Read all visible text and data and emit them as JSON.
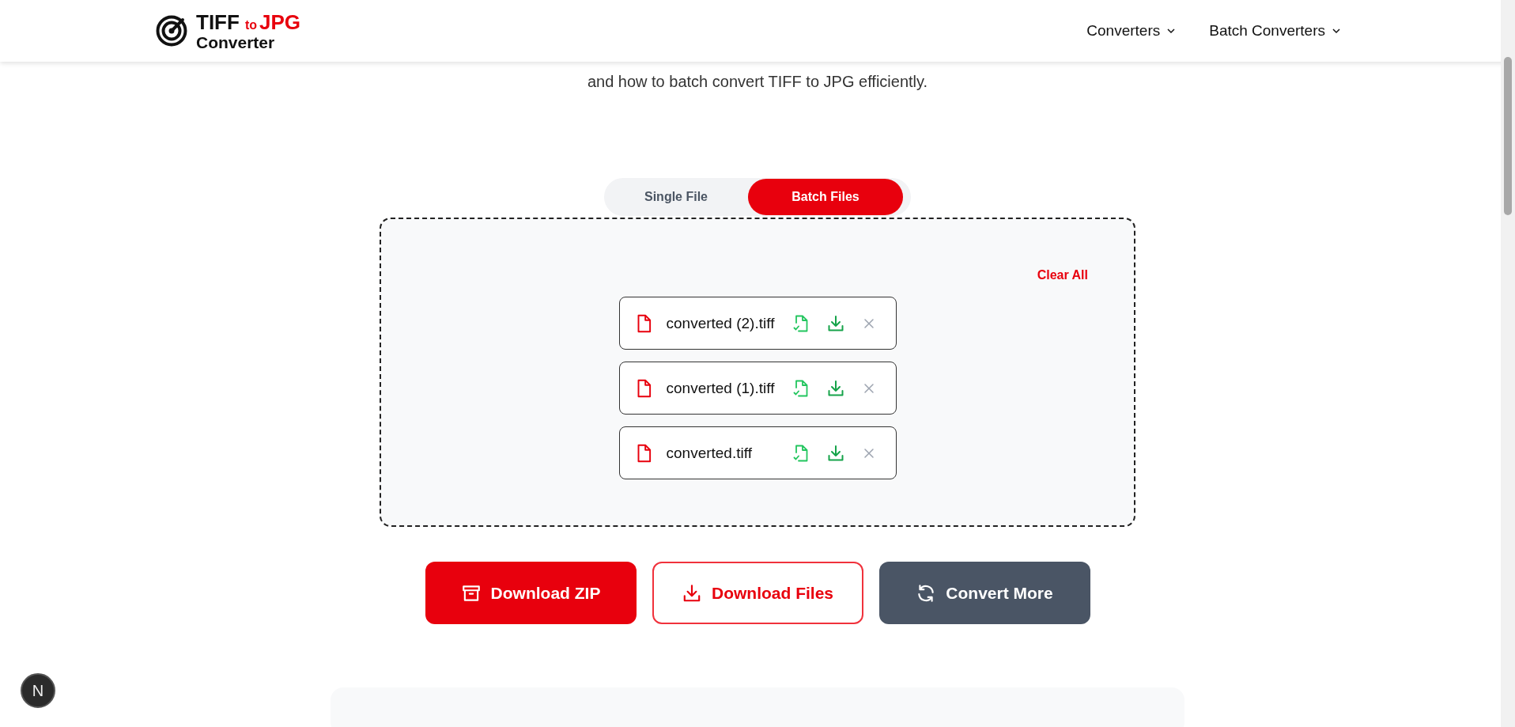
{
  "header": {
    "logo": {
      "word_1": "TIFF",
      "word_2": "to",
      "word_3": "JPG",
      "word_4": "Converter"
    },
    "nav": [
      {
        "label": "Converters"
      },
      {
        "label": "Batch Converters"
      }
    ]
  },
  "intro": {
    "text": "and how to batch convert TIFF to JPG efficiently."
  },
  "mode_tabs": [
    {
      "label": "Single File",
      "selected": false
    },
    {
      "label": "Batch Files",
      "selected": true
    }
  ],
  "dropzone": {
    "clear_all": "Clear All",
    "files": [
      {
        "name": "converted (2).tiff"
      },
      {
        "name": "converted (1).tiff"
      },
      {
        "name": "converted.tiff"
      }
    ]
  },
  "actions": [
    {
      "kind": "zip",
      "label": "Download ZIP"
    },
    {
      "kind": "files",
      "label": "Download Files"
    },
    {
      "kind": "more",
      "label": "Convert More"
    }
  ],
  "dev_badge": {
    "letter": "N"
  }
}
